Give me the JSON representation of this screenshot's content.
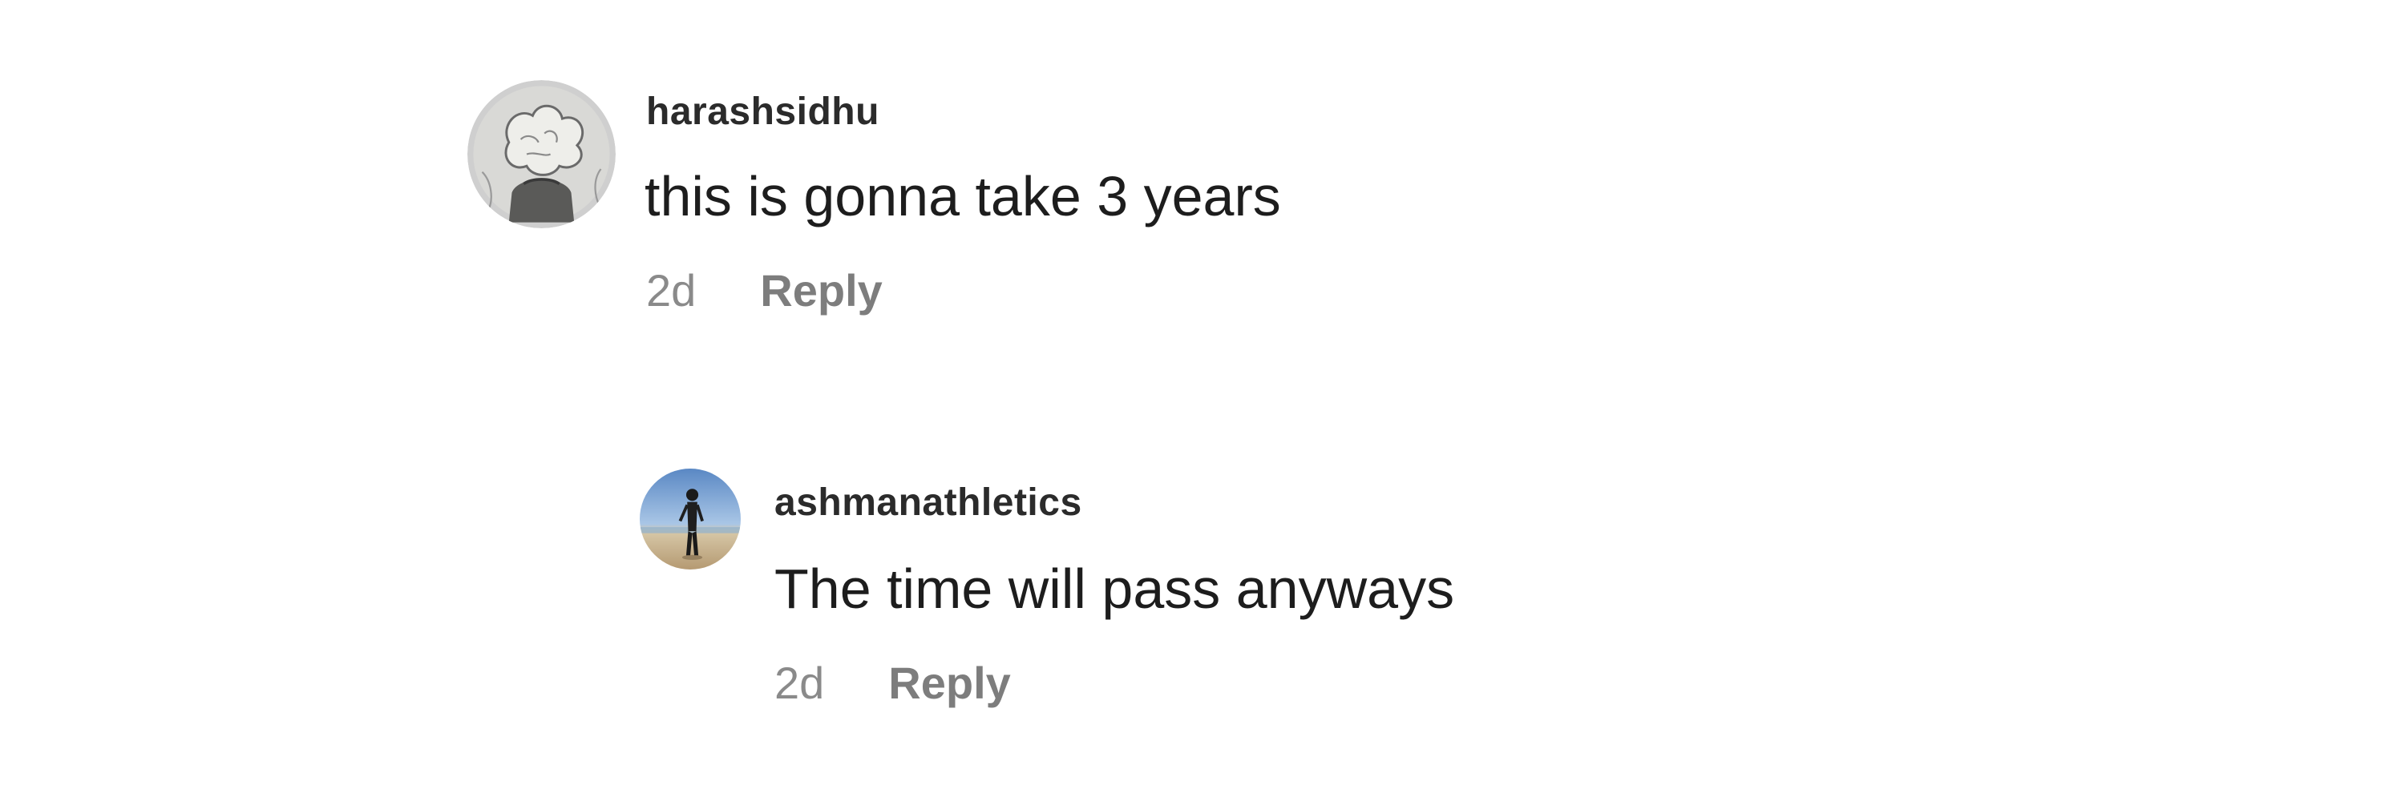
{
  "comments": [
    {
      "avatar_icon": "avatar-sketch-image",
      "username": "harashsidhu",
      "text": "this is gonna take 3 years",
      "time": "2d",
      "reply_label": "Reply"
    },
    {
      "avatar_icon": "avatar-photo-person-beach",
      "username": "ashmanathletics",
      "text": "The time will pass anyways",
      "time": "2d",
      "reply_label": "Reply"
    }
  ],
  "colors": {
    "background": "#ffffff",
    "username": "#2b2b2b",
    "text": "#1d1d1d",
    "meta": "#8a8a8a"
  }
}
